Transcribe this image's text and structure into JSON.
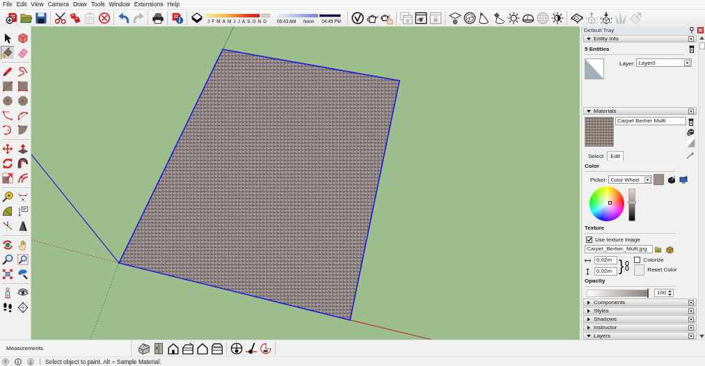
{
  "menu": [
    "File",
    "Edit",
    "View",
    "Camera",
    "Draw",
    "Tools",
    "Window",
    "Extensions",
    "Help"
  ],
  "toolbar": [
    {
      "kind": "buttons",
      "tools": [
        {
          "kind": "get_models",
          "disabled": false
        },
        {
          "kind": "open",
          "disabled": false
        },
        {
          "kind": "save",
          "disabled": false
        }
      ]
    },
    {
      "kind": "buttons",
      "tools": [
        {
          "kind": "cut",
          "disabled": false
        },
        {
          "kind": "copy",
          "disabled": false
        },
        {
          "kind": "paste",
          "disabled": true
        },
        {
          "kind": "erase",
          "disabled": false
        }
      ]
    },
    {
      "kind": "buttons",
      "tools": [
        {
          "kind": "undo",
          "disabled": false
        },
        {
          "kind": "redo",
          "disabled": true
        }
      ]
    },
    {
      "kind": "buttons",
      "tools": [
        {
          "kind": "print",
          "disabled": false
        }
      ]
    },
    {
      "kind": "buttons",
      "tools": [
        {
          "kind": "model_info",
          "disabled": false
        }
      ]
    },
    {
      "kind": "shadow",
      "toggle": {
        "kind": "shadows",
        "disabled": false
      },
      "months": {
        "labels": [
          "J",
          "F",
          "M",
          "A",
          "M",
          "J",
          "J",
          "A",
          "S",
          "O",
          "N",
          "D"
        ],
        "level": 0.86
      },
      "time": {
        "start": "06:43 AM",
        "middle": "Noon",
        "end": "04:45 PM",
        "level": 0.66
      }
    },
    {
      "kind": "buttons",
      "tools": [
        {
          "kind": "v_logo",
          "disabled": false
        },
        {
          "kind": "teapot",
          "disabled": false
        },
        {
          "kind": "teapot_hand",
          "disabled": false
        }
      ]
    },
    {
      "kind": "buttons",
      "tools": [
        {
          "kind": "window_stack",
          "disabled": true
        },
        {
          "kind": "window_teapot",
          "disabled": false
        },
        {
          "kind": "window_lock",
          "disabled": true
        }
      ]
    },
    {
      "kind": "buttons",
      "tools": [
        {
          "kind": "mortarboard",
          "disabled": false
        },
        {
          "kind": "sphere",
          "disabled": false
        },
        {
          "kind": "cone_light",
          "disabled": false
        },
        {
          "kind": "spotlight",
          "disabled": false
        },
        {
          "kind": "sun",
          "disabled": false
        },
        {
          "kind": "dome",
          "disabled": false
        },
        {
          "kind": "globe",
          "disabled": true
        },
        {
          "kind": "half_sun",
          "disabled": false
        }
      ]
    },
    {
      "kind": "buttons",
      "tools": [
        {
          "kind": "terrain",
          "disabled": false
        },
        {
          "kind": "cube_up",
          "disabled": true
        },
        {
          "kind": "cube_down",
          "disabled": false
        },
        {
          "kind": "grass",
          "disabled": true
        },
        {
          "kind": "tilted",
          "disabled": true
        }
      ]
    }
  ],
  "palette": [
    {
      "tools": [
        {
          "kind": "select",
          "selected": false
        },
        {
          "kind": "component",
          "selected": false
        },
        {
          "kind": "paint",
          "selected": true
        },
        {
          "kind": "eraser",
          "selected": false
        }
      ]
    },
    {
      "tools": [
        {
          "kind": "pencil",
          "selected": false
        },
        {
          "kind": "freehand",
          "selected": false
        },
        {
          "kind": "rectangle",
          "selected": false
        },
        {
          "kind": "rotated_rectangle",
          "selected": false
        },
        {
          "kind": "circle",
          "selected": false
        },
        {
          "kind": "polygon",
          "selected": false
        },
        {
          "kind": "arc",
          "selected": false
        },
        {
          "kind": "arc3",
          "selected": false
        },
        {
          "kind": "arc_loop",
          "selected": false
        },
        {
          "kind": "pie",
          "selected": false
        }
      ]
    },
    {
      "tools": [
        {
          "kind": "move",
          "selected": false
        },
        {
          "kind": "push_pull",
          "selected": false
        },
        {
          "kind": "rotate",
          "selected": false
        },
        {
          "kind": "follow_me",
          "selected": false
        },
        {
          "kind": "scale",
          "selected": false
        },
        {
          "kind": "offset",
          "selected": false
        }
      ]
    },
    {
      "tools": [
        {
          "kind": "tape",
          "selected": false
        },
        {
          "kind": "dimension",
          "selected": false
        },
        {
          "kind": "protractor",
          "selected": false
        },
        {
          "kind": "text",
          "selected": false
        },
        {
          "kind": "axes",
          "selected": false
        },
        {
          "kind": "text3d",
          "selected": false
        }
      ]
    },
    {
      "tools": [
        {
          "kind": "orbit",
          "selected": false
        },
        {
          "kind": "pan",
          "selected": false
        },
        {
          "kind": "zoom",
          "selected": false
        },
        {
          "kind": "zoom_window",
          "selected": false
        },
        {
          "kind": "zoom_extents",
          "selected": false
        },
        {
          "kind": "previous",
          "selected": false
        }
      ]
    },
    {
      "tools": [
        {
          "kind": "position_camera",
          "selected": false
        },
        {
          "kind": "look_around",
          "selected": false
        },
        {
          "kind": "walk",
          "selected": false
        },
        {
          "kind": "section_plane",
          "selected": false
        }
      ]
    }
  ],
  "tray": {
    "title": "Default Tray",
    "entity_info": {
      "title": "Entity Info",
      "expanded": true,
      "count": "5 Entities",
      "layer_label": "Layer:",
      "layer": "Layer0"
    },
    "materials": {
      "title": "Materials",
      "expanded": true,
      "name": "Carpet Berber Multi",
      "tabs": [
        {
          "label": "Select",
          "selected": false
        },
        {
          "label": "Edit",
          "selected": true
        }
      ],
      "color_heading": "Color",
      "picker_label": "Picker:",
      "picker": "Color Wheel",
      "brightness": {
        "level": 0.57
      },
      "texture_heading": "Texture",
      "use_texture": {
        "label": "Use texture image",
        "checked": true
      },
      "texture_file": "Carpet_Berber_Multi.jpg",
      "width": "0,02m",
      "height": "0,02m",
      "link_brace": "}",
      "colorize": {
        "label": "Colorize",
        "checked": false
      },
      "reset_label": "Reset Color",
      "opacity_heading": "Opacity",
      "opacity": {
        "level": 1,
        "value": "100"
      }
    },
    "sections": [
      {
        "title": "Components",
        "expanded": false
      },
      {
        "title": "Styles",
        "expanded": false
      },
      {
        "title": "Shadows",
        "expanded": false
      },
      {
        "title": "Instructor",
        "expanded": false
      },
      {
        "title": "Layers",
        "expanded": true
      }
    ]
  },
  "measurements": {
    "label": "Measurements"
  },
  "view_toolbar": [
    {
      "tools": [
        {
          "kind": "iso"
        },
        {
          "kind": "top"
        },
        {
          "kind": "front"
        },
        {
          "kind": "right"
        },
        {
          "kind": "back"
        },
        {
          "kind": "left"
        }
      ]
    },
    {
      "tools": [
        {
          "kind": "section_display"
        },
        {
          "kind": "section_cuts"
        },
        {
          "kind": "section_fill"
        }
      ]
    }
  ],
  "status_bar": {
    "text": "Select object to paint. Alt = Sample Material."
  }
}
